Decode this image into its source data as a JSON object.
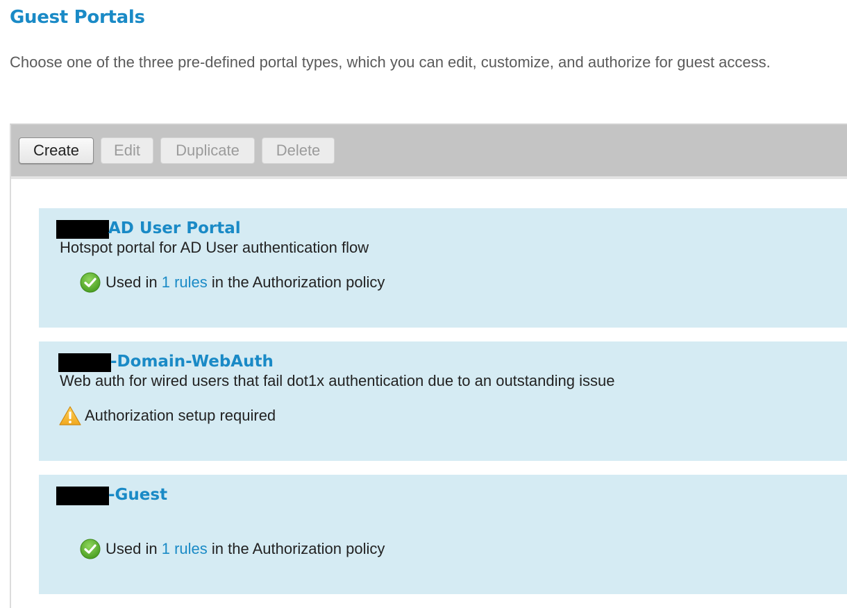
{
  "page": {
    "title": "Guest Portals",
    "description": "Choose one of the three pre-defined portal types, which you can edit, customize, and authorize for guest access."
  },
  "toolbar": {
    "create_label": "Create",
    "edit_label": "Edit",
    "duplicate_label": "Duplicate",
    "delete_label": "Delete"
  },
  "portals": [
    {
      "title": "AD User Portal",
      "description": "Hotspot portal for AD User authentication flow",
      "status_icon": "check-circle-icon",
      "status_prefix": "Used in ",
      "status_link": "1 rules",
      "status_suffix": " in the Authorization policy"
    },
    {
      "title": "-Domain-WebAuth",
      "description": "Web auth for wired users that fail dot1x authentication due to an outstanding issue",
      "status_icon": "warning-icon",
      "status_text": "Authorization setup required"
    },
    {
      "title": "-Guest",
      "description": "",
      "status_icon": "check-circle-icon",
      "status_prefix": "Used in ",
      "status_link": "1 rules",
      "status_suffix": " in the Authorization policy"
    }
  ],
  "colors": {
    "accent": "#1a8ac6",
    "card_background": "#d5ebf3",
    "toolbar_background": "#c4c4c4",
    "success": "#5cb132",
    "warning": "#f0a81e"
  }
}
